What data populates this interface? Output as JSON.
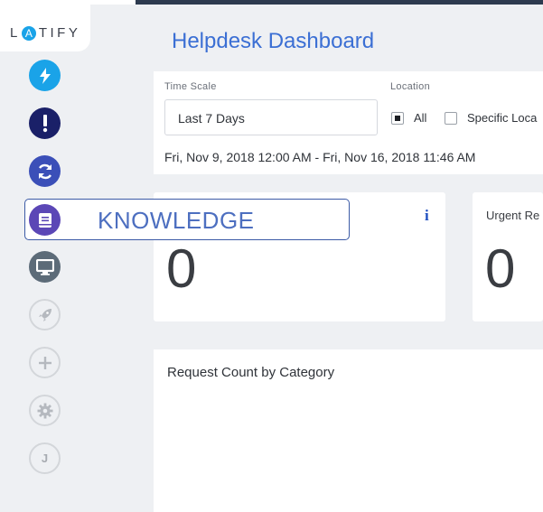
{
  "logo": {
    "pre": "L",
    "accent": "A",
    "post": "TIFY"
  },
  "page": {
    "title": "Helpdesk Dashboard"
  },
  "sidebar": {
    "items": [
      {
        "name": "Quick actions",
        "icon": "lightning-icon",
        "color": "#1aa3e8"
      },
      {
        "name": "Alerts",
        "icon": "exclamation-icon",
        "color": "#1a2068"
      },
      {
        "name": "Sync",
        "icon": "refresh-icon",
        "color": "#3b4fb8"
      },
      {
        "name": "Knowledge",
        "icon": "book-icon",
        "color": "#5b47b6"
      },
      {
        "name": "Devices",
        "icon": "monitor-icon",
        "color": "#5c6b78"
      },
      {
        "name": "Deploy",
        "icon": "rocket-icon",
        "color": "#c4c7cc"
      },
      {
        "name": "Add",
        "icon": "plus-icon",
        "color": "#c4c7cc"
      },
      {
        "name": "Settings",
        "icon": "gear-icon",
        "color": "#c4c7cc"
      },
      {
        "name": "User",
        "icon": "avatar-icon",
        "initial": "J",
        "color": "#c4c7cc"
      }
    ],
    "tooltip": "KNOWLEDGE"
  },
  "filters": {
    "time_scale_label": "Time Scale",
    "time_scale_value": "Last 7 Days",
    "location_label": "Location",
    "location_all": "All",
    "location_all_checked": true,
    "location_specific": "Specific Loca",
    "location_specific_checked": false,
    "date_range": "Fri, Nov 9, 2018 12:00 AM - Fri, Nov 16, 2018 11:46 AM"
  },
  "cards": {
    "first": {
      "value": "0",
      "info": "i"
    },
    "second": {
      "title": "Urgent Re",
      "value": "0"
    }
  },
  "chart": {
    "title": "Request Count by Category"
  }
}
